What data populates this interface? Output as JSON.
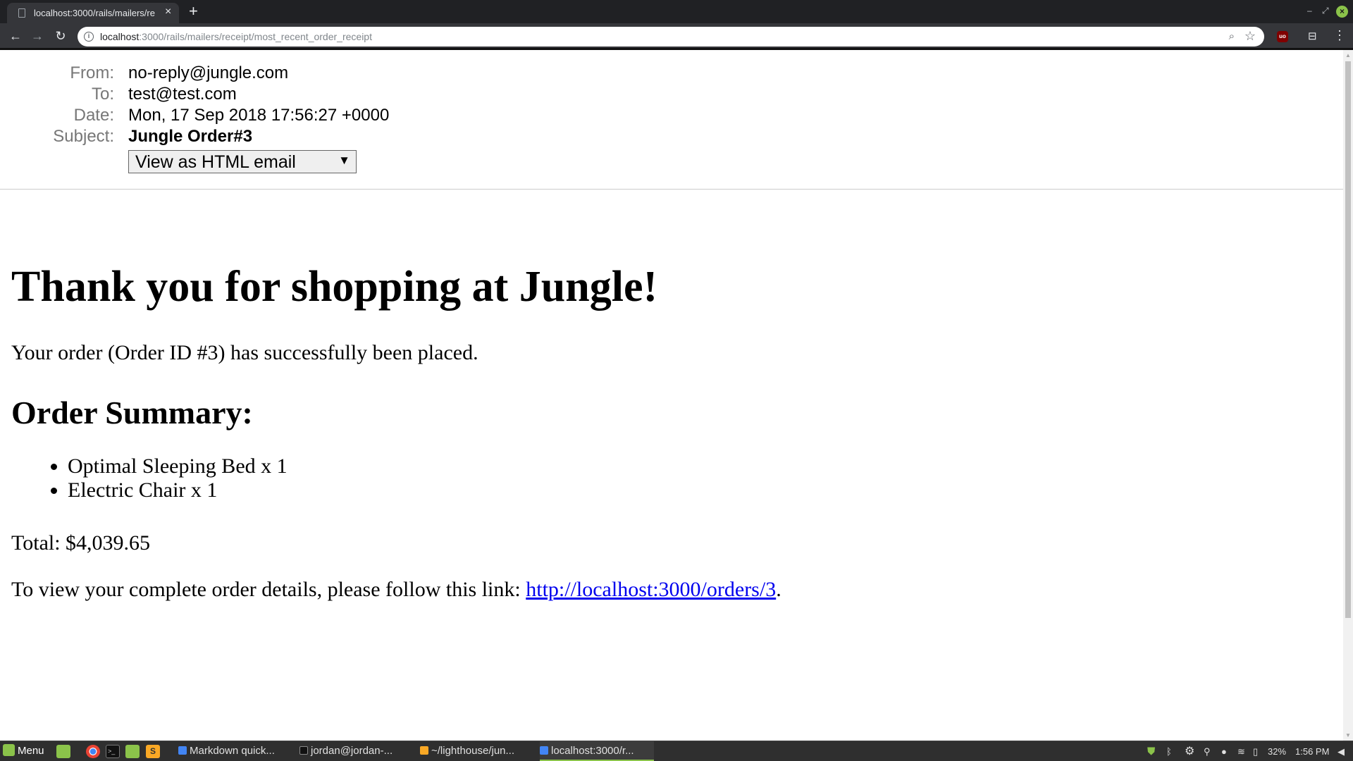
{
  "browser": {
    "tab_title": "localhost:3000/rails/mailers/re",
    "tab_close": "×",
    "new_tab": "+",
    "url_host": "localhost",
    "url_rest": ":3000/rails/mailers/receipt/most_recent_order_receipt",
    "ext_label": "uo"
  },
  "mail_header": {
    "from_label": "From:",
    "from_value": "no-reply@jungle.com",
    "to_label": "To:",
    "to_value": "test@test.com",
    "date_label": "Date:",
    "date_value": "Mon, 17 Sep 2018 17:56:27 +0000",
    "subject_label": "Subject:",
    "subject_value": "Jungle Order#3",
    "format_selected": "View as HTML email"
  },
  "email": {
    "heading": "Thank you for shopping at Jungle!",
    "intro": "Your order (Order ID #3) has successfully been placed.",
    "summary_heading": "Order Summary:",
    "items": [
      "Optimal Sleeping Bed x 1",
      "Electric Chair x 1"
    ],
    "total": "Total: $4,039.65",
    "link_prefix": "To view your complete order details, please follow this link: ",
    "link_text": "http://localhost:3000/orders/3",
    "link_suffix": "."
  },
  "taskbar": {
    "menu_label": "Menu",
    "tasks": [
      "Markdown quick...",
      "jordan@jordan-...",
      "~/lighthouse/jun...",
      "localhost:3000/r..."
    ],
    "battery": "32%",
    "clock": "1:56 PM"
  },
  "colors": {
    "link": "#0000ee",
    "mint_green": "#8bc34a",
    "chrome_dark": "#35363a"
  }
}
